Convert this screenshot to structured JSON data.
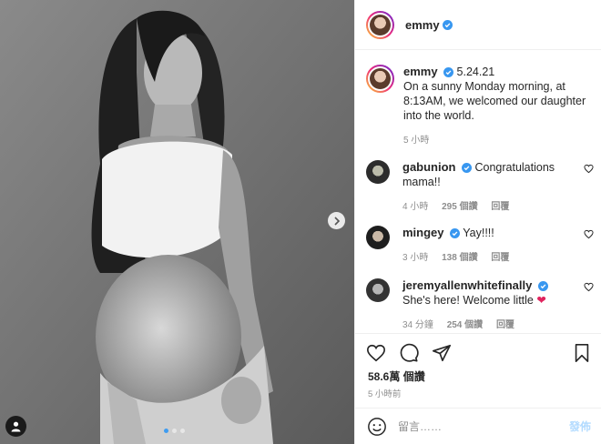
{
  "header": {
    "username": "emmy"
  },
  "caption": {
    "username": "emmy",
    "date": "5.24.21",
    "text": "On a sunny Monday morning, at 8:13AM, we welcomed our daughter into the world.",
    "time": "5 小時"
  },
  "comments": [
    {
      "username": "gabunion",
      "text": "Congratulations mama!!",
      "time": "4 小時",
      "likes": "295 個讚",
      "reply": "回覆"
    },
    {
      "username": "mingey",
      "text": "Yay!!!!",
      "time": "3 小時",
      "likes": "138 個讚",
      "reply": "回覆"
    },
    {
      "username": "jeremyallenwhitefinally",
      "text": "She's here! Welcome little",
      "time": "34 分鐘",
      "likes": "254 個讚",
      "reply": "回覆"
    }
  ],
  "stats": {
    "views": "58.6萬 個讚",
    "posted": "5 小時前"
  },
  "add_comment": {
    "placeholder": "留言……",
    "post_label": "發佈"
  },
  "icons": [
    "verified-badge",
    "heart",
    "comment",
    "share",
    "bookmark",
    "emoji",
    "next-arrow",
    "user-tag"
  ],
  "colors": {
    "verified": "#3897f0",
    "link_disabled": "#b3dbff",
    "meta": "#8e8e8e",
    "red_heart": "#e0245e"
  }
}
